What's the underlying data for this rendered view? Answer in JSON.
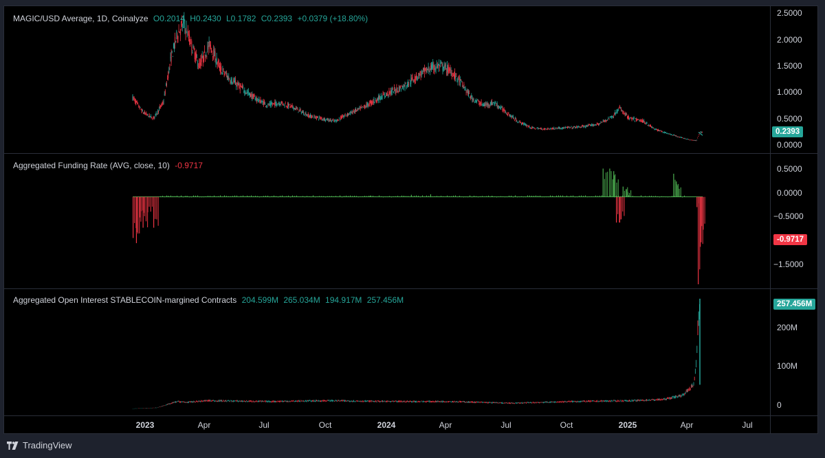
{
  "panes": [
    {
      "id": "price",
      "legend": {
        "symbol": "MAGIC/USD Average, 1D, Coinalyze",
        "open": "O0.2014",
        "high": "H0.2430",
        "low": "L0.1782",
        "close": "C0.2393",
        "change": "+0.0379 (+18.80%)"
      },
      "last_value_tag": "0.2393",
      "axis_ticks": [
        "2.5000",
        "2.0000",
        "1.5000",
        "1.0000",
        "0.5000",
        "0.0000"
      ]
    },
    {
      "id": "funding",
      "legend": {
        "title": "Aggregated Funding Rate (AVG, close, 10)",
        "value": "-0.9717"
      },
      "last_value_tag": "-0.9717",
      "axis_ticks": [
        "0.5000",
        "0.0000",
        "−0.5000",
        "−1.5000"
      ]
    },
    {
      "id": "open_interest",
      "legend": {
        "title": "Aggregated Open Interest STABLECOIN-margined Contracts",
        "v1": "204.599M",
        "v2": "265.034M",
        "v3": "194.917M",
        "v4": "257.456M"
      },
      "last_value_tag": "257.456M",
      "axis_ticks": [
        "200M",
        "100M",
        "0"
      ]
    }
  ],
  "x_axis": {
    "labels": [
      {
        "text": "2023",
        "bold": true
      },
      {
        "text": "Apr",
        "bold": false
      },
      {
        "text": "Jul",
        "bold": false
      },
      {
        "text": "Oct",
        "bold": false
      },
      {
        "text": "2024",
        "bold": true
      },
      {
        "text": "Apr",
        "bold": false
      },
      {
        "text": "Jul",
        "bold": false
      },
      {
        "text": "Oct",
        "bold": false
      },
      {
        "text": "2025",
        "bold": true
      },
      {
        "text": "Apr",
        "bold": false
      },
      {
        "text": "Jul",
        "bold": false
      }
    ]
  },
  "footer": {
    "brand": "TradingView"
  },
  "colors": {
    "up": "#26a69a",
    "down": "#f23645",
    "funding_up": "#4caf50",
    "background": "#000000"
  },
  "chart_data": [
    {
      "type": "line",
      "title": "MAGIC/USD Average, 1D, Coinalyze",
      "ylim": [
        0,
        2.5
      ],
      "x": [
        "2022-12-10",
        "2022-12-25",
        "2023-01-10",
        "2023-01-25",
        "2023-02-05",
        "2023-02-15",
        "2023-02-25",
        "2023-03-08",
        "2023-03-20",
        "2023-04-05",
        "2023-04-20",
        "2023-05-05",
        "2023-05-20",
        "2023-06-10",
        "2023-07-01",
        "2023-07-20",
        "2023-08-10",
        "2023-09-01",
        "2023-09-20",
        "2023-10-10",
        "2023-11-01",
        "2023-11-20",
        "2023-12-10",
        "2024-01-01",
        "2024-01-20",
        "2024-02-10",
        "2024-03-01",
        "2024-03-15",
        "2024-04-01",
        "2024-04-15",
        "2024-05-01",
        "2024-05-20",
        "2024-06-05",
        "2024-06-25",
        "2024-07-10",
        "2024-08-01",
        "2024-08-20",
        "2024-09-10",
        "2024-10-01",
        "2024-10-20",
        "2024-11-10",
        "2024-12-01",
        "2024-12-10",
        "2024-12-25",
        "2025-01-15",
        "2025-02-01",
        "2025-02-20",
        "2025-03-10",
        "2025-03-25",
        "2025-04-05",
        "2025-04-10"
      ],
      "series": [
        {
          "values": [
            0.9,
            0.62,
            0.5,
            0.8,
            1.6,
            2.1,
            2.3,
            1.9,
            1.5,
            1.9,
            1.45,
            1.25,
            1.1,
            0.9,
            0.75,
            0.8,
            0.7,
            0.55,
            0.5,
            0.45,
            0.6,
            0.7,
            0.85,
            1.0,
            1.1,
            1.3,
            1.45,
            1.5,
            1.4,
            1.2,
            0.9,
            0.75,
            0.8,
            0.6,
            0.45,
            0.32,
            0.3,
            0.32,
            0.33,
            0.35,
            0.4,
            0.55,
            0.7,
            0.5,
            0.45,
            0.3,
            0.22,
            0.15,
            0.1,
            0.08,
            0.24
          ]
        }
      ]
    },
    {
      "type": "bar",
      "title": "Aggregated Funding Rate (AVG, close, 10)",
      "ylim": [
        -1.7,
        0.65
      ],
      "x": [
        "2022-12-10",
        "2022-12-15",
        "2022-12-20",
        "2022-12-25",
        "2023-01-01",
        "2023-01-10",
        "2023-02-01",
        "2023-03-01",
        "2023-06-01",
        "2023-09-01",
        "2023-12-01",
        "2024-02-01",
        "2024-03-01",
        "2024-06-01",
        "2024-09-01",
        "2024-11-15",
        "2024-11-25",
        "2024-12-01",
        "2024-12-05",
        "2024-12-10",
        "2024-12-15",
        "2024-12-20",
        "2025-03-01",
        "2025-03-05",
        "2025-04-05",
        "2025-04-07",
        "2025-04-10"
      ],
      "series": [
        {
          "values": [
            -0.8,
            -0.9,
            -0.4,
            -0.6,
            -0.3,
            -0.6,
            0.02,
            0.02,
            0.01,
            0.01,
            0.02,
            0.04,
            0.05,
            0.02,
            0.01,
            0.55,
            0.55,
            0.5,
            -0.5,
            -0.5,
            0.2,
            0.15,
            0.45,
            0.3,
            -0.2,
            -1.7,
            -0.9717
          ]
        }
      ]
    },
    {
      "type": "line",
      "title": "Aggregated Open Interest STABLECOIN-margined Contracts",
      "ylim": [
        0,
        265
      ],
      "x": [
        "2022-12-10",
        "2023-01-15",
        "2023-02-15",
        "2023-03-01",
        "2023-04-01",
        "2023-07-01",
        "2023-10-01",
        "2024-01-01",
        "2024-04-01",
        "2024-07-01",
        "2024-10-01",
        "2025-01-01",
        "2025-02-15",
        "2025-03-15",
        "2025-03-25",
        "2025-04-01",
        "2025-04-05",
        "2025-04-07",
        "2025-04-10"
      ],
      "series": [
        {
          "values": [
            3,
            5,
            20,
            18,
            22,
            20,
            22,
            20,
            20,
            16,
            20,
            22,
            25,
            35,
            50,
            60,
            120,
            200,
            257.456
          ]
        }
      ]
    }
  ]
}
